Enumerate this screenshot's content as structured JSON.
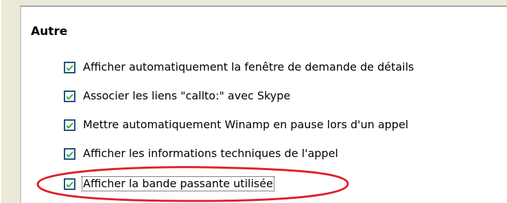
{
  "section": {
    "title": "Autre"
  },
  "options": [
    {
      "label": "Afficher automatiquement la fenêtre de demande de détails",
      "checked": true
    },
    {
      "label": "Associer les liens \"callto:\" avec Skype",
      "checked": true
    },
    {
      "label": "Mettre automatiquement Winamp en pause lors d'un appel",
      "checked": true
    },
    {
      "label": "Afficher les informations techniques de l'appel",
      "checked": true
    },
    {
      "label": "Afficher la bande passante utilisée",
      "checked": true
    }
  ],
  "colors": {
    "checkbox_border": "#1c5180",
    "checkmark": "#21a121",
    "annotation_ellipse": "#e0202a",
    "panel_background": "#ffffff",
    "window_background": "#ece9d8"
  },
  "icons": {
    "checkmark": "checkmark-icon"
  }
}
